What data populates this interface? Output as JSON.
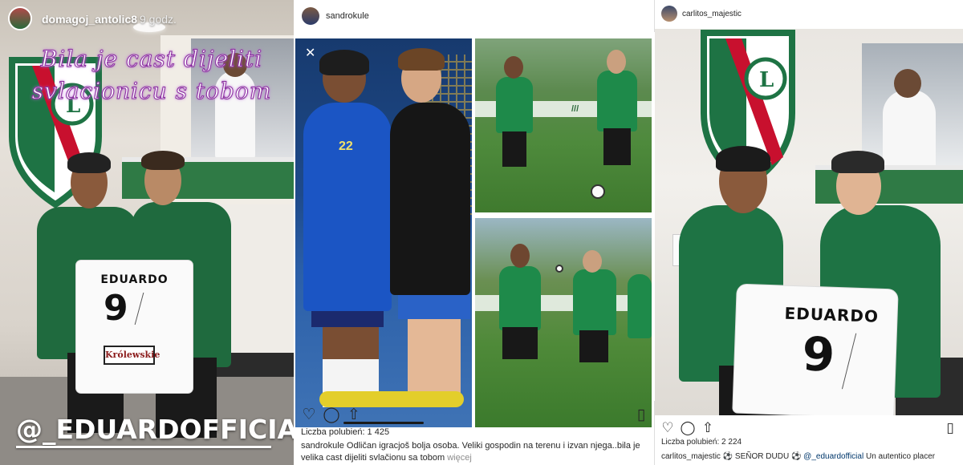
{
  "story": {
    "username": "domagoj_antolic8",
    "time": "9 godz.",
    "handwritten_text": "Bila je cast dijeliti svlacionicu s tobom",
    "mention_tag": "@_EDUARDOFFICIAL",
    "shirt": {
      "name": "EDUARDO",
      "number": "9",
      "sponsor": "Królewskie"
    }
  },
  "post1": {
    "username": "sandrokule",
    "photo_labels": {
      "jersey_number": "22"
    },
    "likes": "Liczba polubień: 1 425",
    "caption_user": "sandrokule",
    "caption_text": "Odličan igracjoš bolja osoba. Veliki gospodin na terenu i izvan njega..bila je velika cast dijeliti svlačionu sa tobom",
    "more_label": "więcej",
    "icons": [
      "heart-icon",
      "comment-icon",
      "share-icon",
      "bookmark-icon",
      "close-icon"
    ]
  },
  "post2": {
    "username": "carlitos_majestic",
    "shirt": {
      "name": "EDUARDO",
      "number": "9"
    },
    "likes": "Liczba polubień: 2 224",
    "caption_user": "carlitos_majestic",
    "caption_pre": "⚽ SEÑOR DUDU ⚽",
    "caption_mention": "@_eduardofficial",
    "caption_post": "Un autentico placer",
    "icons": [
      "heart-icon",
      "comment-icon",
      "share-icon",
      "bookmark-icon"
    ]
  },
  "colors": {
    "legia_green": "#1e7344",
    "handwriting_glow": "#8b2fa0",
    "instagram_text": "#262626",
    "instagram_muted": "#8e8e8e",
    "instagram_link": "#00376b"
  }
}
